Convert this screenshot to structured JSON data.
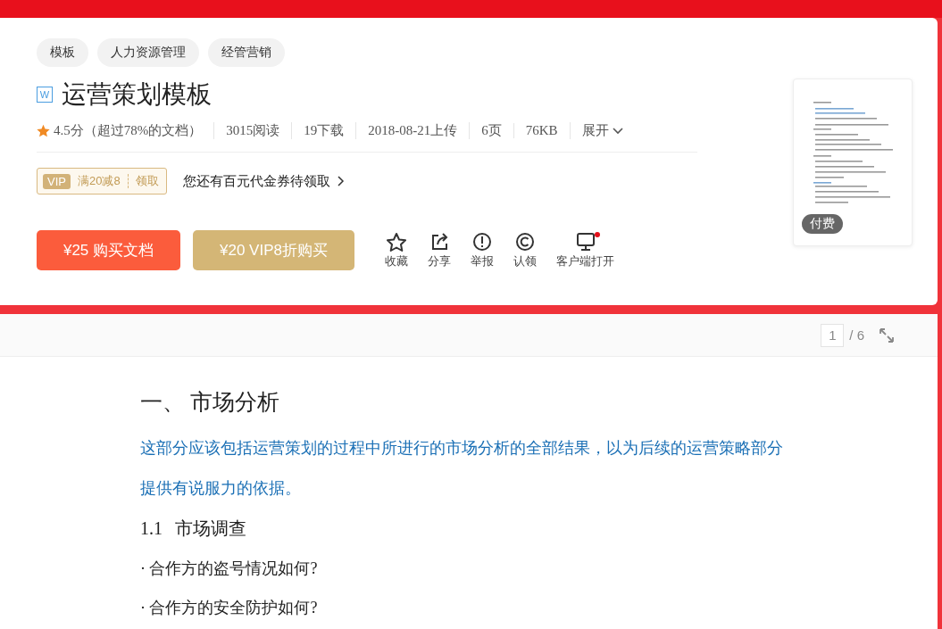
{
  "tags": [
    "模板",
    "人力资源管理",
    "经管营销"
  ],
  "title": "运营策划模板",
  "file_badge": "W",
  "meta": {
    "rating": "4.5分（超过78%的文档）",
    "items": [
      "3015阅读",
      "19下载",
      "2018-08-21上传",
      "6页",
      "76KB"
    ],
    "expand": "展开"
  },
  "coupon": {
    "vip": "VIP",
    "offer": "满20减8",
    "claim": "领取",
    "notice": "您还有百元代金券待领取"
  },
  "buttons": [
    {
      "kind": "buy",
      "label": "¥25 购买文档"
    },
    {
      "kind": "vip",
      "label": "¥20 VIP8折购买"
    }
  ],
  "actions": [
    {
      "kind": "star",
      "label": "收藏"
    },
    {
      "kind": "share",
      "label": "分享"
    },
    {
      "kind": "report",
      "label": "举报"
    },
    {
      "kind": "claim",
      "label": "认领"
    },
    {
      "kind": "client",
      "label": "客户端打开"
    }
  ],
  "thumbnail": {
    "badge": "付费"
  },
  "pager": {
    "current": "1",
    "total": "/ 6"
  },
  "document": [
    {
      "kind": "h1",
      "text": "一、 市场分析"
    },
    {
      "kind": "blue",
      "text": "这部分应该包括运营策划的过程中所进行的市场分析的全部结果，以为后续的运营策略部分"
    },
    {
      "kind": "blue",
      "text": "提供有说服力的依据。"
    },
    {
      "kind": "h2",
      "num": "1.1",
      "text": "市场调查"
    },
    {
      "kind": "item",
      "text": "· 合作方的盗号情况如何?"
    },
    {
      "kind": "item",
      "text": "· 合作方的安全防护如何?"
    }
  ]
}
